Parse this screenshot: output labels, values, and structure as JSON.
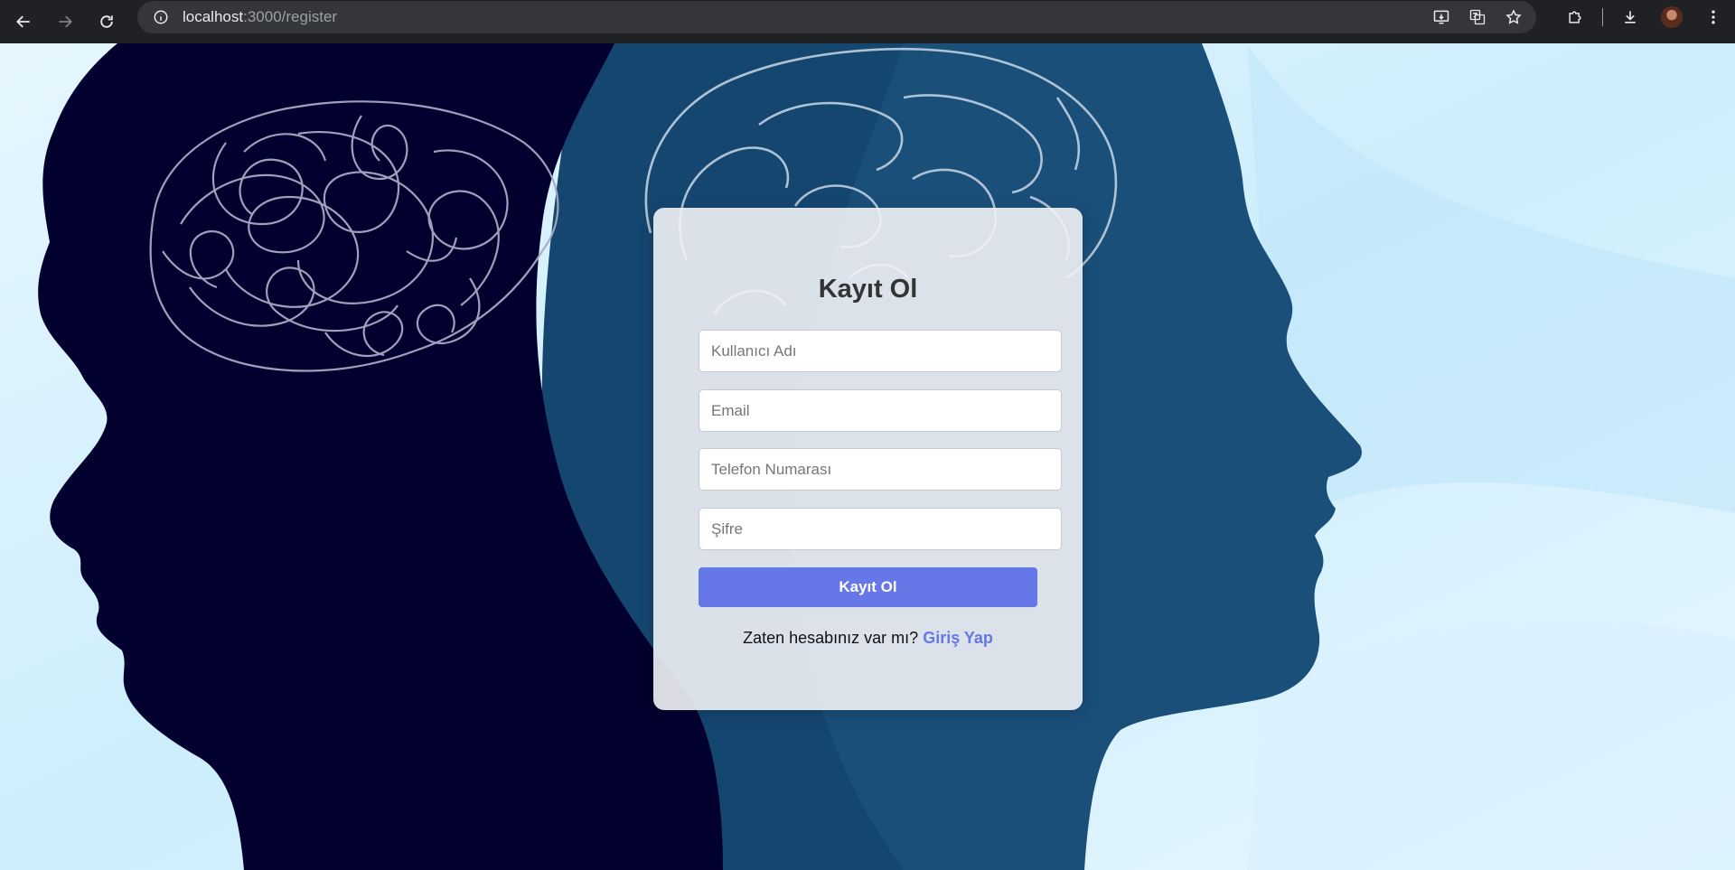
{
  "browser": {
    "url_host": "localhost",
    "url_path": ":3000/register",
    "back_icon": "arrow-left-icon",
    "forward_icon": "arrow-right-icon",
    "reload_icon": "reload-icon",
    "info_icon": "info-icon",
    "install_icon": "install-app-icon",
    "translate_icon": "translate-icon",
    "bookmark_icon": "star-icon",
    "extensions_icon": "puzzle-icon",
    "download_icon": "download-icon",
    "menu_icon": "kebab-menu-icon"
  },
  "register": {
    "title": "Kayıt Ol",
    "username_placeholder": "Kullanıcı Adı",
    "email_placeholder": "Email",
    "phone_placeholder": "Telefon Numarası",
    "password_placeholder": "Şifre",
    "submit_label": "Kayıt Ol",
    "login_prompt": "Zaten hesabınız var mı?",
    "login_link": "Giriş Yap"
  },
  "colors": {
    "accent": "#6678e8",
    "background_light": "#cfeefc",
    "silhouette_dark": "#02002e",
    "silhouette_blue": "#1a4f7a"
  }
}
